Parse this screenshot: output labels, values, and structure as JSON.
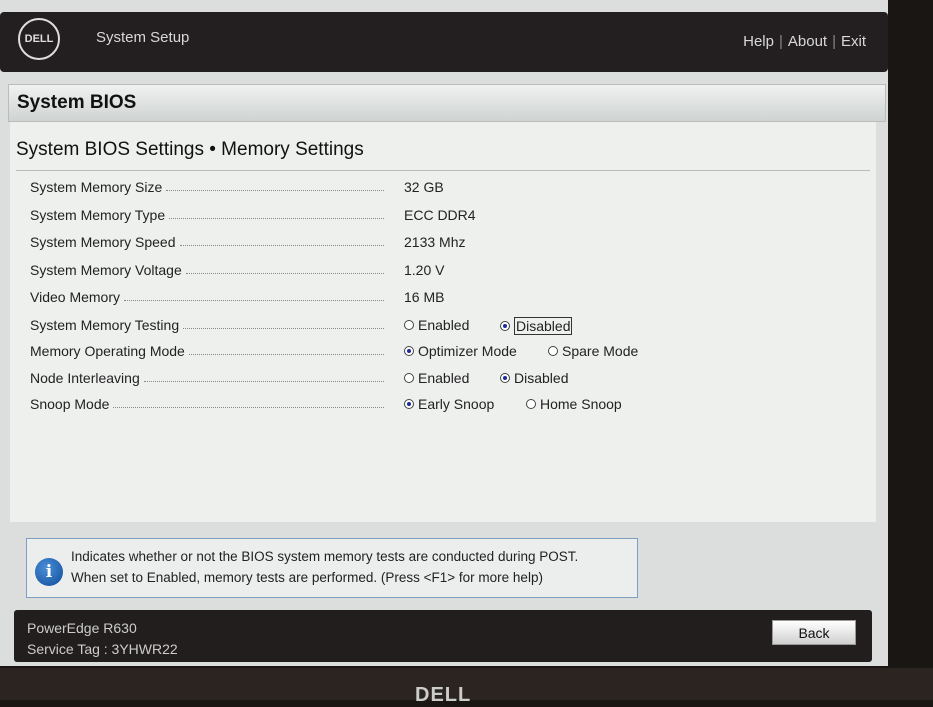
{
  "header": {
    "logo": "DELL",
    "title": "System Setup",
    "links": [
      "Help",
      "About",
      "Exit"
    ]
  },
  "section": "System BIOS",
  "page_title": "System BIOS Settings • Memory Settings",
  "rows": [
    {
      "label": "System Memory Size",
      "value": "32 GB"
    },
    {
      "label": "System Memory Type",
      "value": "ECC DDR4"
    },
    {
      "label": "System Memory Speed",
      "value": "2133 Mhz"
    },
    {
      "label": "System Memory Voltage",
      "value": "1.20 V"
    },
    {
      "label": "Video Memory",
      "value": "16 MB"
    },
    {
      "label": "System Memory Testing",
      "options": [
        {
          "label": "Enabled",
          "selected": false
        },
        {
          "label": "Disabled",
          "selected": true
        }
      ]
    },
    {
      "label": "Memory Operating Mode",
      "options": [
        {
          "label": "Optimizer Mode",
          "selected": true
        },
        {
          "label": "Spare Mode",
          "selected": false
        }
      ]
    },
    {
      "label": "Node Interleaving",
      "options": [
        {
          "label": "Enabled",
          "selected": false
        },
        {
          "label": "Disabled",
          "selected": true
        }
      ]
    },
    {
      "label": "Snoop Mode",
      "options": [
        {
          "label": "Early Snoop",
          "selected": true
        },
        {
          "label": "Home Snoop",
          "selected": false
        }
      ]
    }
  ],
  "help": {
    "icon": "info-icon",
    "line1": "Indicates whether or not the BIOS system memory tests are conducted during POST.",
    "line2": "When set to Enabled, memory tests are performed. (Press <F1> for more help)"
  },
  "footer": {
    "model": "PowerEdge R630",
    "service_tag": "Service Tag : 3YHWR22",
    "back": "Back"
  },
  "bezel_brand": "DELL"
}
